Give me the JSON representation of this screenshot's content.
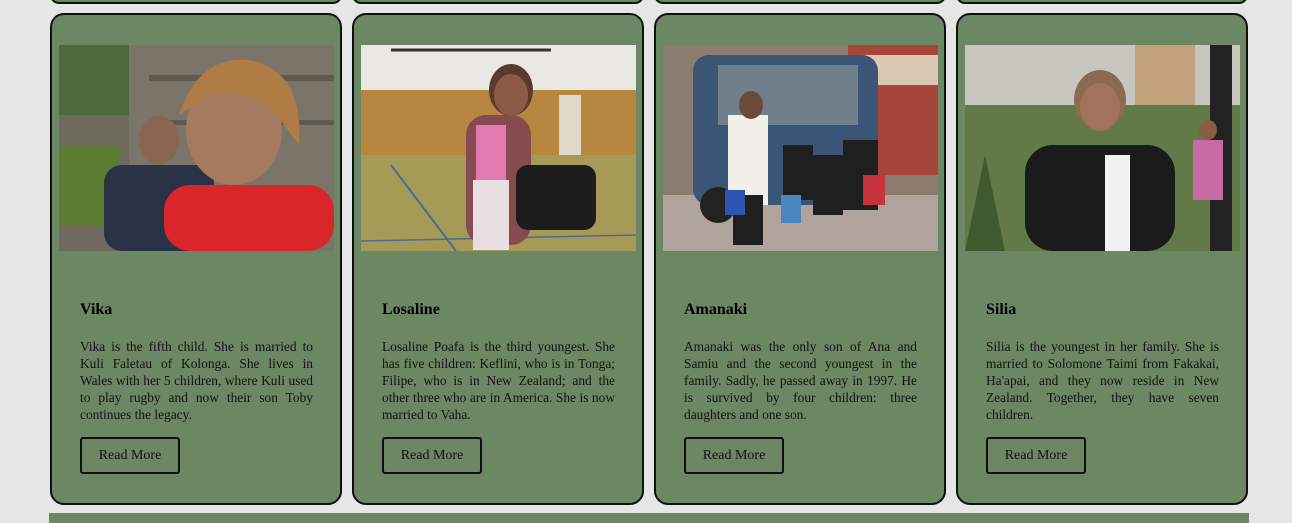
{
  "cards": [
    {
      "name": "Vika",
      "description": "Vika is the fifth child. She is married to Kuli Faletau of Kolonga. She lives in Wales with her 5 children, where Kuli used to play rugby and now their son Toby continues the legacy.",
      "button": "Read More"
    },
    {
      "name": "Losaline",
      "description": "Losaline Poafa is the third youngest. She has five children: Keflini, who is in Tonga; Filipe, who is in New Zealand; and the other three who are in America. She is now married to Vaha.",
      "button": "Read More"
    },
    {
      "name": "Amanaki",
      "description": "Amanaki was the only son of Ana and Samiu and the second youngest in the family. Sadly, he passed away in 1997. He is survived by four children: three daughters and one son.",
      "button": "Read More"
    },
    {
      "name": "Silia",
      "description": "Silia is the youngest in her family. She is married to Solomone Taimi from Fakakai, Ha'apai, and they now reside in New Zealand. Together, they have seven children.",
      "button": "Read More"
    }
  ],
  "theme": {
    "card_bg": "#6b8763",
    "page_bg": "#e6e6e6",
    "border": "#111111"
  }
}
